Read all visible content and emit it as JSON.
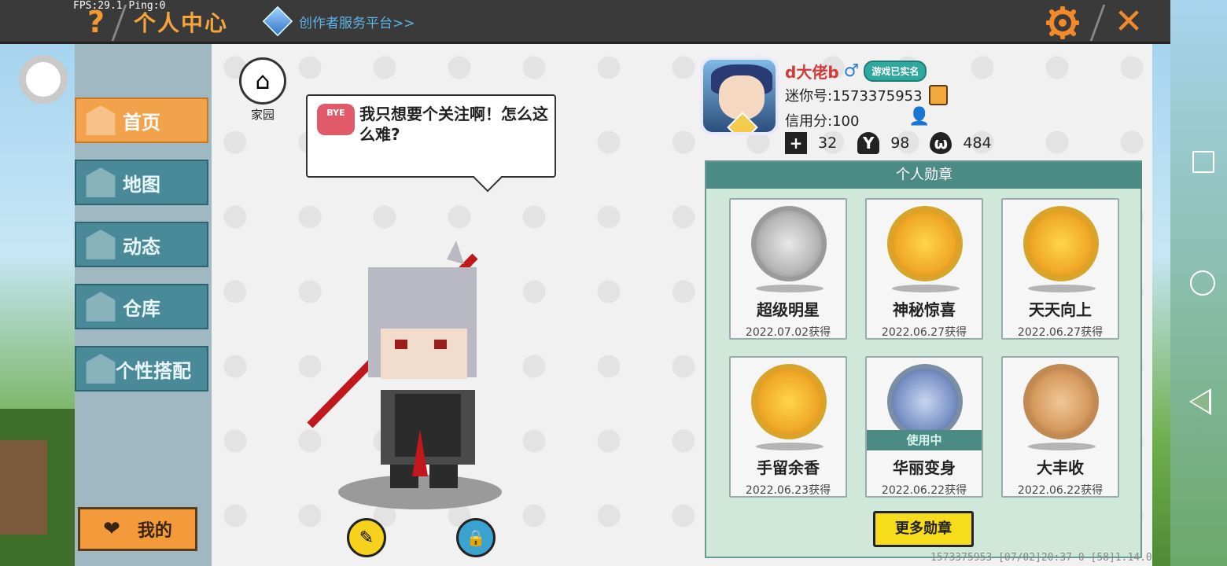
{
  "hud": {
    "fps": "FPS:29.1  Ping:0"
  },
  "header": {
    "title": "个人中心",
    "help": "?",
    "creator_link": "创作者服务平台>>",
    "close": "✕"
  },
  "nav": {
    "items": [
      {
        "label": "首页",
        "icon": "home-icon",
        "active": true
      },
      {
        "label": "地图",
        "icon": "map-icon",
        "active": false
      },
      {
        "label": "动态",
        "icon": "bell-icon",
        "active": false
      },
      {
        "label": "仓库",
        "icon": "warehouse-icon",
        "active": false
      },
      {
        "label": "个性搭配",
        "icon": "outfit-icon",
        "active": false
      }
    ],
    "mine_label": "我的"
  },
  "home": {
    "label": "家园"
  },
  "bubble": {
    "badge": "BYE",
    "text": "我只想要个关注啊！怎么这么难?"
  },
  "profile": {
    "nickname": "d大佬b",
    "gender_icon": "male-icon",
    "realname_badge": "游戏已实名",
    "mini_id": "迷你号:1573375953",
    "credit": "信用分:100",
    "stats": {
      "follow": "32",
      "fans": "98",
      "heat": "484"
    }
  },
  "medals": {
    "header": "个人勋章",
    "items": [
      {
        "name": "超级明星",
        "date": "2022.07.02获得",
        "style": "silver",
        "in_use": ""
      },
      {
        "name": "神秘惊喜",
        "date": "2022.06.27获得",
        "style": "gold",
        "in_use": ""
      },
      {
        "name": "天天向上",
        "date": "2022.06.27获得",
        "style": "gold",
        "in_use": ""
      },
      {
        "name": "手留余香",
        "date": "2022.06.23获得",
        "style": "gold",
        "in_use": ""
      },
      {
        "name": "华丽变身",
        "date": "2022.06.22获得",
        "style": "blue",
        "in_use": "使用中"
      },
      {
        "name": "大丰收",
        "date": "2022.06.22获得",
        "style": "copper",
        "in_use": ""
      }
    ],
    "more_label": "更多勋章"
  },
  "footer": {
    "meta": "1573375953   [07/02]20:37 0  [58]1.14.0"
  },
  "colors": {
    "accent": "#f3a24c",
    "teal": "#4b8a85",
    "yellow": "#f7dc1b"
  }
}
